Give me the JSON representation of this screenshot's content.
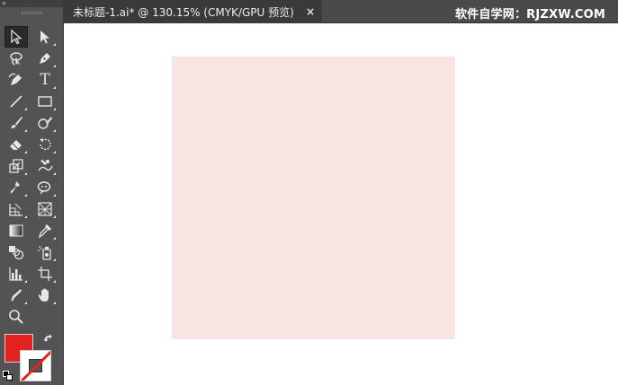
{
  "toolbar": {
    "collapse_glyph": "«",
    "tools": [
      {
        "name": "selection-tool-icon",
        "active": true
      },
      {
        "name": "direct-selection-tool-icon"
      },
      {
        "name": "lasso-tool-icon"
      },
      {
        "name": "pen-tool-icon"
      },
      {
        "name": "curvature-tool-icon"
      },
      {
        "name": "type-tool-icon",
        "glyph": "T"
      },
      {
        "name": "line-segment-tool-icon"
      },
      {
        "name": "rectangle-tool-icon"
      },
      {
        "name": "paintbrush-tool-icon"
      },
      {
        "name": "shaper-tool-icon"
      },
      {
        "name": "eraser-tool-icon"
      },
      {
        "name": "rotate-tool-icon"
      },
      {
        "name": "scale-tool-icon"
      },
      {
        "name": "warp-tool-icon"
      },
      {
        "name": "puppet-warp-tool-icon"
      },
      {
        "name": "free-transform-tool-icon"
      },
      {
        "name": "shape-builder-tool-icon"
      },
      {
        "name": "perspective-grid-tool-icon"
      },
      {
        "name": "gradient-tool-icon"
      },
      {
        "name": "eyedropper-tool-icon"
      },
      {
        "name": "blend-tool-icon"
      },
      {
        "name": "symbol-sprayer-tool-icon"
      },
      {
        "name": "column-graph-tool-icon"
      },
      {
        "name": "artboard-tool-icon"
      },
      {
        "name": "slice-tool-icon"
      },
      {
        "name": "hand-tool-icon"
      },
      {
        "name": "zoom-tool-icon"
      }
    ],
    "fill_color": "#e3231f",
    "stroke": "none"
  },
  "tab": {
    "title": "未标题-1.ai* @ 130.15% (CMYK/GPU 预览)",
    "close_glyph": "×"
  },
  "watermark": "软件自学网：RJZXW.COM",
  "canvas": {
    "shape_fill": "#f9e4e3"
  }
}
